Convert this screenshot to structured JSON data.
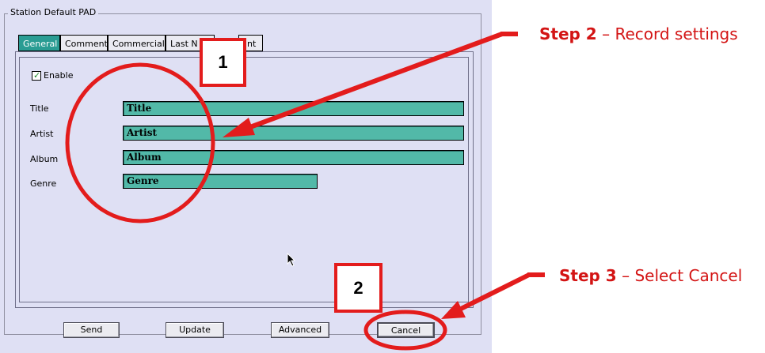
{
  "group": {
    "title": "Station Default PAD"
  },
  "tabs": [
    {
      "label": "General",
      "active": true
    },
    {
      "label": "Comment",
      "active": false
    },
    {
      "label": "Commercial",
      "active": false
    },
    {
      "label": "Last N",
      "active": false
    },
    {
      "label": "nt",
      "active": false
    }
  ],
  "enable": {
    "label": "Enable",
    "checked": true
  },
  "fields": [
    {
      "label": "Title",
      "value": "Title"
    },
    {
      "label": "Artist",
      "value": "Artist"
    },
    {
      "label": "Album",
      "value": "Album"
    },
    {
      "label": "Genre",
      "value": "Genre"
    }
  ],
  "buttons": {
    "send": "Send",
    "update": "Update",
    "advanced": "Advanced",
    "cancel": "Cancel"
  },
  "annotations": {
    "box1": "1",
    "box2": "2",
    "step2": {
      "bold": "Step 2",
      "rest": " – Record settings"
    },
    "step3": {
      "bold": "Step 3",
      "rest": " – Select Cancel"
    }
  },
  "colors": {
    "panel_bg": "#dfe0f4",
    "field_bg": "#52b9a8",
    "active_tab": "#2a9c93",
    "annotation_red": "#e31c1c"
  }
}
